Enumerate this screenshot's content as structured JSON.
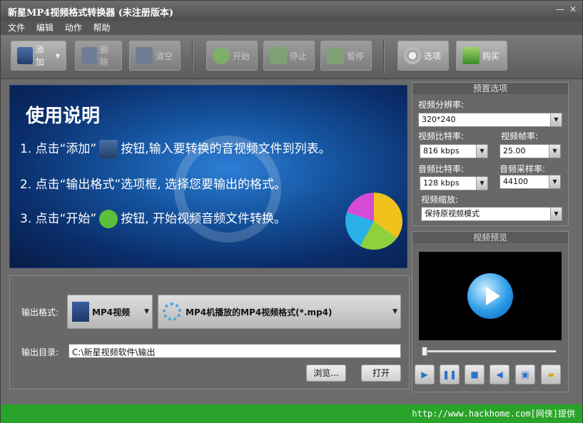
{
  "window": {
    "title": "新星MP4视频格式转换器 (未注册版本)",
    "min": "—",
    "close": "✕"
  },
  "menu": [
    "文件",
    "编辑",
    "动作",
    "帮助"
  ],
  "toolbar": {
    "add": "添加",
    "delete": "删除",
    "clear": "清空",
    "start": "开始",
    "stop": "停止",
    "pause": "暂停",
    "options": "选项",
    "buy": "购买"
  },
  "banner": {
    "heading": "使用说明",
    "line1_a": "1. 点击“添加”",
    "line1_b": "按钮,输入要转换的音视频文件到列表。",
    "line2": "2. 点击“输出格式”选项框, 选择您要输出的格式。",
    "line3_a": "3. 点击“开始”",
    "line3_b": "按钮, 开始视频音频文件转换。"
  },
  "output": {
    "format_label": "输出格式:",
    "format_type": "MP4视频",
    "format_detail": "MP4机播放的MP4视频格式(*.mp4)",
    "dir_label": "输出目录:",
    "dir_value": "C:\\新星视频软件\\输出",
    "browse": "浏览...",
    "open": "打开"
  },
  "presets": {
    "title": "预置选项",
    "resolution_label": "视频分辨率:",
    "resolution": "320*240",
    "vbitrate_label": "视频比特率:",
    "vbitrate": "816 kbps",
    "framerate_label": "视频帧率:",
    "framerate": "25.00",
    "abitrate_label": "音频比特率:",
    "abitrate": "128 kbps",
    "samplerate_label": "音频采样率:",
    "samplerate": "44100",
    "scale_label": "视频缩放:",
    "scale": "保持原视频模式"
  },
  "preview": {
    "title": "视频预览"
  },
  "status": {
    "text": "http://www.hackhome.com[网侠]提供"
  }
}
